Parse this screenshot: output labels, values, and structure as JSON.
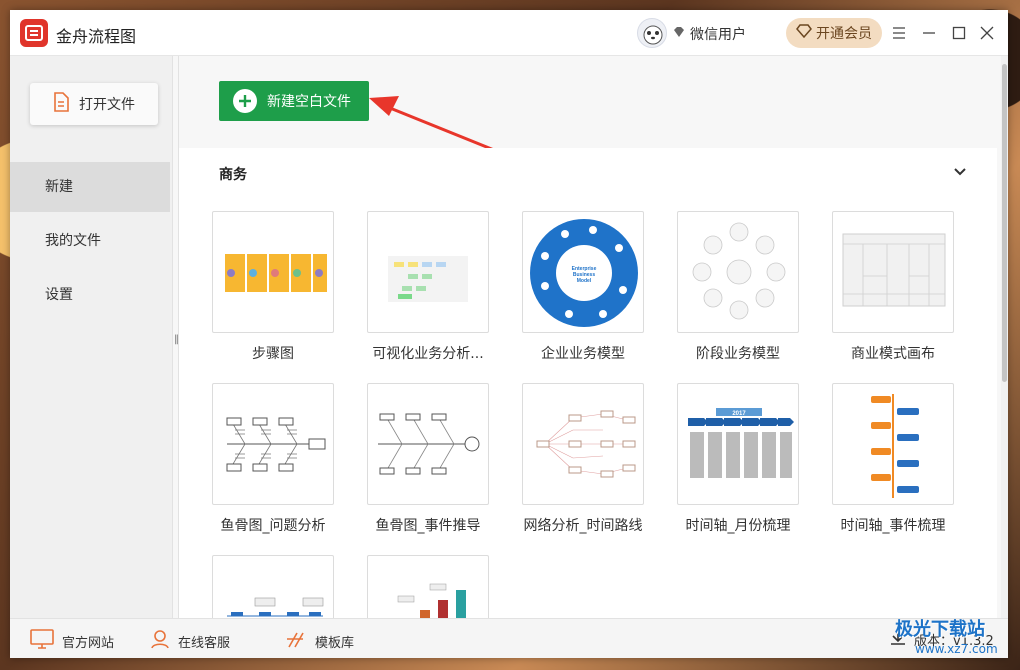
{
  "app": {
    "title": "金舟流程图",
    "user_name": "微信用户",
    "vip_label": "开通会员"
  },
  "sidebar": {
    "open_file_label": "打开文件",
    "items": [
      {
        "label": "新建",
        "active": true
      },
      {
        "label": "我的文件",
        "active": false
      },
      {
        "label": "设置",
        "active": false
      }
    ]
  },
  "main": {
    "new_blank_label": "新建空白文件",
    "section_title": "商务",
    "templates": [
      {
        "label": "步骤图"
      },
      {
        "label": "可视化业务分析..."
      },
      {
        "label": "企业业务模型"
      },
      {
        "label": "阶段业务模型"
      },
      {
        "label": "商业模式画布"
      },
      {
        "label": "鱼骨图_问题分析"
      },
      {
        "label": "鱼骨图_事件推导"
      },
      {
        "label": "网络分析_时间路线"
      },
      {
        "label": "时间轴_月份梳理"
      },
      {
        "label": "时间轴_事件梳理"
      },
      {
        "label": ""
      },
      {
        "label": ""
      }
    ],
    "thumb_text": {
      "enterprise": "Enterprise Business Model",
      "year": "2017"
    }
  },
  "footer": {
    "website_label": "官方网站",
    "support_label": "在线客服",
    "templates_label": "模板库",
    "version_label": "版本：v1.3.2"
  },
  "watermark": {
    "text": "极光下载站",
    "url": "www.xz7.com"
  },
  "colors": {
    "brand_red": "#e0352b",
    "primary_green": "#1e9e4a",
    "vip_bg": "#f3dcc1",
    "arrow_red": "#e8362b"
  }
}
